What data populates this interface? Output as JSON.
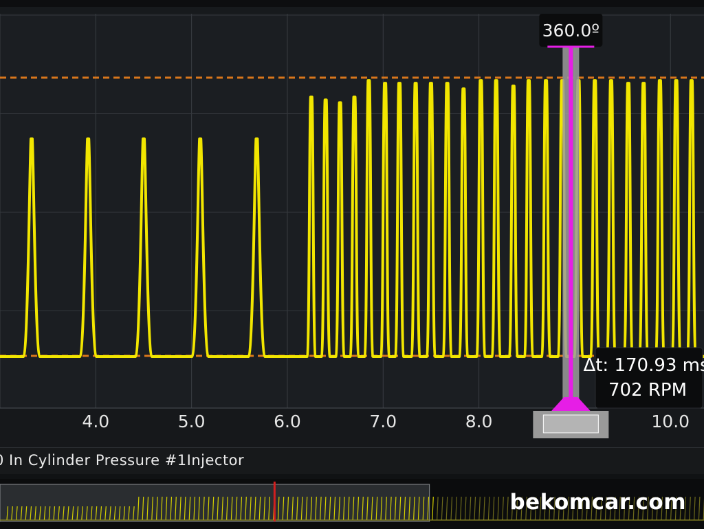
{
  "chart_data": {
    "type": "line",
    "title": "",
    "xlabel": "",
    "ylabel": "",
    "xlim": [
      3.0,
      10.35
    ],
    "ylim": [
      0,
      100
    ],
    "x_ticks": [
      "4.0",
      "5.0",
      "6.0",
      "7.0",
      "8.0",
      "10.0"
    ],
    "series": [
      {
        "name": "In Cylinder Pressure #1Injector",
        "color": "#f2e600",
        "peaks": [
          {
            "x": 3.33,
            "y": 78
          },
          {
            "x": 3.92,
            "y": 78
          },
          {
            "x": 4.5,
            "y": 78
          },
          {
            "x": 5.09,
            "y": 78
          },
          {
            "x": 5.68,
            "y": 78
          },
          {
            "x": 6.25,
            "y": 93
          },
          {
            "x": 6.4,
            "y": 92
          },
          {
            "x": 6.55,
            "y": 91
          },
          {
            "x": 6.7,
            "y": 93
          },
          {
            "x": 6.85,
            "y": 99
          },
          {
            "x": 7.02,
            "y": 98
          },
          {
            "x": 7.17,
            "y": 98
          },
          {
            "x": 7.34,
            "y": 98
          },
          {
            "x": 7.5,
            "y": 98
          },
          {
            "x": 7.67,
            "y": 98
          },
          {
            "x": 7.84,
            "y": 96
          },
          {
            "x": 8.02,
            "y": 99
          },
          {
            "x": 8.18,
            "y": 99
          },
          {
            "x": 8.36,
            "y": 97
          },
          {
            "x": 8.52,
            "y": 99
          },
          {
            "x": 8.7,
            "y": 99
          },
          {
            "x": 8.87,
            "y": 99
          },
          {
            "x": 9.04,
            "y": 99
          },
          {
            "x": 9.21,
            "y": 99
          },
          {
            "x": 9.38,
            "y": 99
          },
          {
            "x": 9.56,
            "y": 98
          },
          {
            "x": 9.72,
            "y": 98
          },
          {
            "x": 9.89,
            "y": 99
          },
          {
            "x": 10.06,
            "y": 99
          },
          {
            "x": 10.22,
            "y": 99
          }
        ]
      }
    ],
    "reference_lines": [
      {
        "y": 100,
        "color": "#d9771c",
        "style": "dashed"
      },
      {
        "y": 0,
        "color": "#d9771c",
        "style": "dashed"
      }
    ],
    "cursor": {
      "x": 8.96,
      "color": "#e61ee6",
      "angle_label": "360.0º"
    },
    "grid": true,
    "legend": "none"
  },
  "readout": {
    "delta_t": "Δt: 170.93 ms",
    "rpm": "702 RPM"
  },
  "channel": {
    "name": "0 In Cylinder Pressure #1Injector"
  },
  "overview": {
    "window_start": 0.0,
    "window_end": 0.61,
    "marker_position": 0.39
  },
  "watermark": "bekomcar.com"
}
